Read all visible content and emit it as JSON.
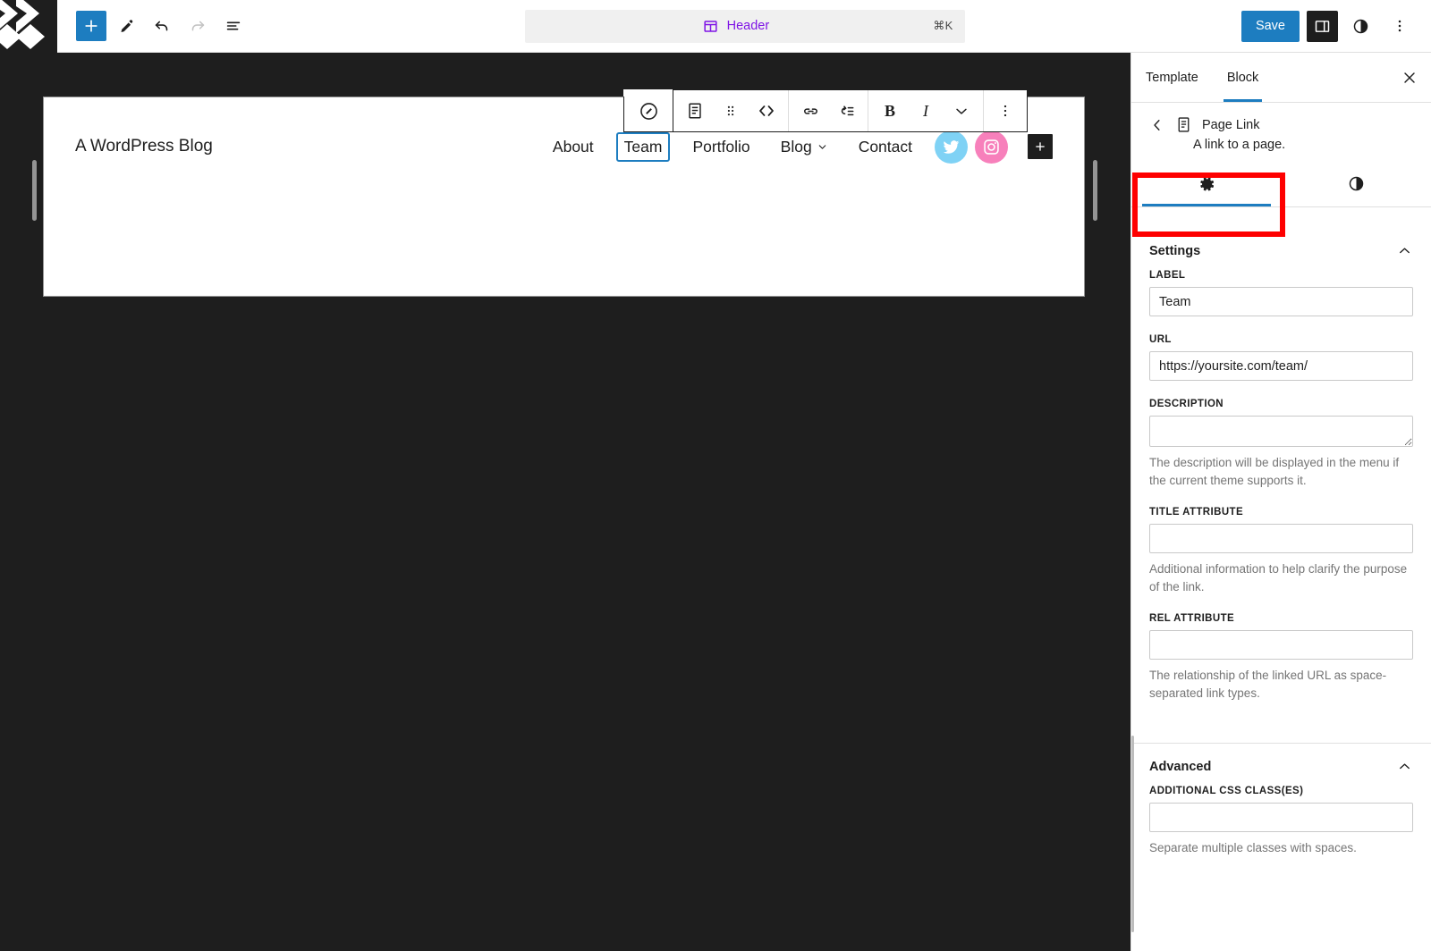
{
  "topbar": {
    "logo_icon": "wordpress-logo-icon",
    "add_block_label": "+",
    "add_block_icon": "plus-icon",
    "tools": [
      {
        "name": "edit-tool",
        "icon": "pencil-icon"
      },
      {
        "name": "undo",
        "icon": "undo-arrow-icon"
      },
      {
        "name": "redo",
        "icon": "redo-arrow-icon"
      },
      {
        "name": "list-view",
        "icon": "list-view-icon"
      }
    ],
    "document": {
      "icon": "template-part-icon",
      "title": "Header",
      "shortcut": "⌘K",
      "title_color": "#7f14e6"
    },
    "save_label": "Save",
    "save_color": "#1d7dc0",
    "sidebar_toggle_icon": "settings-panel-icon",
    "styles_icon": "half-circle-icon",
    "options_icon": "three-dots-vertical-icon"
  },
  "block_toolbar": {
    "block_switcher_icon": "navigation-compass-icon",
    "buttons": [
      {
        "name": "page-link-block-icon",
        "icon": "page-icon"
      },
      {
        "name": "drag-handle",
        "icon": "six-dots-drag-icon"
      },
      {
        "name": "move-arrows",
        "icon": "chevron-left-right-icon"
      },
      {
        "name": "link-button",
        "icon": "link-icon"
      },
      {
        "name": "add-submenu-button",
        "icon": "submenu-icon"
      },
      {
        "name": "bold-button",
        "icon": "B"
      },
      {
        "name": "italic-button",
        "icon": "I"
      },
      {
        "name": "more-formats-button",
        "icon": "chevron-down-icon"
      },
      {
        "name": "block-options-button",
        "icon": "three-dots-vertical-icon"
      }
    ],
    "bold_glyph": "B",
    "italic_glyph": "I"
  },
  "canvas": {
    "site_title": "A WordPress Blog",
    "nav_items": [
      {
        "label": "About",
        "selected": false,
        "has_chevron": false
      },
      {
        "label": "Team",
        "selected": true,
        "has_chevron": false
      },
      {
        "label": "Portfolio",
        "selected": false,
        "has_chevron": false
      },
      {
        "label": "Blog",
        "selected": false,
        "has_chevron": true
      },
      {
        "label": "Contact",
        "selected": false,
        "has_chevron": false
      }
    ],
    "social": [
      {
        "name": "twitter-icon",
        "color": "#7fd2f5"
      },
      {
        "name": "instagram-icon",
        "color": "#f780bb"
      }
    ],
    "appender_label": "+",
    "selected_outline_color": "#1d7dc0",
    "left_resize_handle": "left-resize-handle",
    "right_resize_handle": "right-resize-handle"
  },
  "sidebar": {
    "tabs": [
      {
        "label": "Template",
        "active": false
      },
      {
        "label": "Block",
        "active": true
      }
    ],
    "active_underline_color": "#1d7dc0",
    "close_icon": "close-icon",
    "block": {
      "back_icon": "chevron-left-icon",
      "icon": "page-icon",
      "name": "Page Link",
      "description": "A link to a page."
    },
    "mode_tabs": [
      {
        "name": "settings-tab",
        "icon": "gear-icon",
        "active": true
      },
      {
        "name": "styles-tab",
        "icon": "half-circle-icon",
        "active": false
      }
    ],
    "annotation_color": "#fe0000",
    "settings_panel": {
      "title": "Settings",
      "collapse_icon": "chevron-up-icon",
      "fields": [
        {
          "name": "label-field",
          "label": "LABEL",
          "value": "Team",
          "placeholder": "",
          "type": "input",
          "help": ""
        },
        {
          "name": "url-field",
          "label": "URL",
          "value": "https://yoursite.com/team/",
          "placeholder": "",
          "type": "input",
          "help": ""
        },
        {
          "name": "description-field",
          "label": "DESCRIPTION",
          "value": "",
          "placeholder": "",
          "type": "textarea",
          "help": "The description will be displayed in the menu if the current theme supports it."
        },
        {
          "name": "title-attribute-field",
          "label": "TITLE ATTRIBUTE",
          "value": "",
          "placeholder": "",
          "type": "input",
          "help": "Additional information to help clarify the purpose of the link."
        },
        {
          "name": "rel-attribute-field",
          "label": "REL ATTRIBUTE",
          "value": "",
          "placeholder": "",
          "type": "input",
          "help": "The relationship of the linked URL as space-separated link types."
        }
      ]
    },
    "advanced_panel": {
      "title": "Advanced",
      "collapse_icon": "chevron-up-icon",
      "fields": [
        {
          "name": "additional-css-classes-field",
          "label": "ADDITIONAL CSS CLASS(ES)",
          "value": "",
          "placeholder": "",
          "type": "input",
          "help": "Separate multiple classes with spaces."
        }
      ]
    }
  }
}
